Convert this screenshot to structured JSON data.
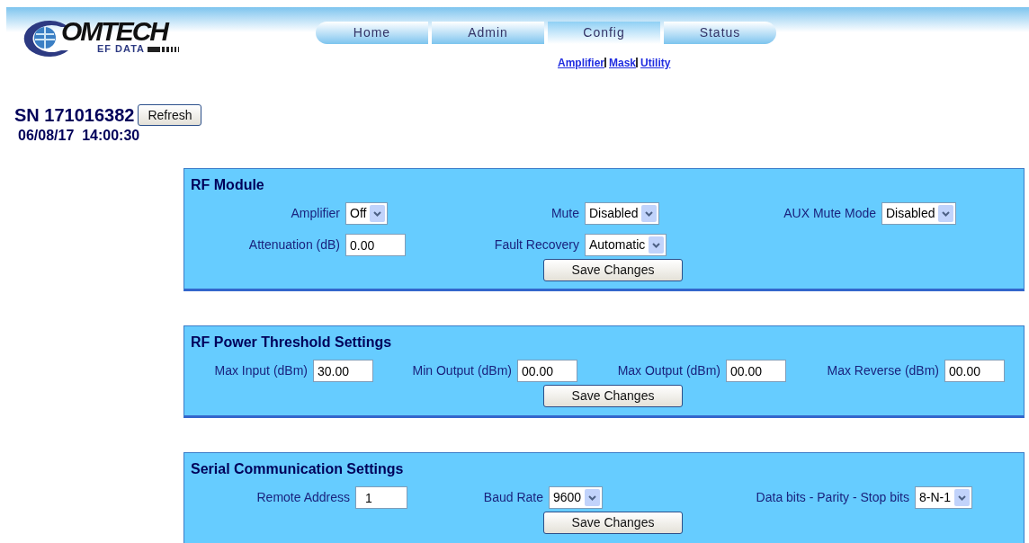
{
  "logo": {
    "wordmark": "OMTECH",
    "subtitle": "EF DATA"
  },
  "tabs": [
    {
      "label": "Home",
      "selected": false
    },
    {
      "label": "Admin",
      "selected": false
    },
    {
      "label": "Config",
      "selected": true
    },
    {
      "label": "Status",
      "selected": false
    }
  ],
  "sub_links": [
    "Amplifier",
    "Mask",
    "Utility"
  ],
  "serial_number": "SN 171016382",
  "refresh_button": "Refresh",
  "datetime": "06/08/17  14:00:30",
  "panels": [
    {
      "title": "RF Module",
      "rows": [
        [
          {
            "label": "Amplifier",
            "kind": "select",
            "value": "Off"
          },
          {
            "label": "Mute",
            "kind": "select",
            "value": "Disabled"
          },
          {
            "label": "AUX Mute Mode",
            "kind": "select",
            "value": "Disabled"
          }
        ],
        [
          {
            "label": "Attenuation (dB)",
            "kind": "text",
            "value": "0.00"
          },
          {
            "label": "Fault Recovery",
            "kind": "select",
            "value": "Automatic"
          }
        ]
      ],
      "button": "Save Changes"
    },
    {
      "title": "RF Power Threshold Settings",
      "rows": [
        [
          {
            "label": "Max Input (dBm)",
            "kind": "text",
            "value": "30.00"
          },
          {
            "label": "Min Output (dBm)",
            "kind": "text",
            "value": "00.00"
          },
          {
            "label": "Max Output (dBm)",
            "kind": "text",
            "value": "00.00"
          },
          {
            "label": "Max Reverse (dBm)",
            "kind": "text",
            "value": "00.00"
          }
        ]
      ],
      "button": "Save Changes"
    },
    {
      "title": "Serial Communication Settings",
      "rows": [
        [
          {
            "label": "Remote Address",
            "kind": "text",
            "value": "1"
          },
          {
            "label": "Baud Rate",
            "kind": "select",
            "value": "9600"
          },
          {
            "label": "Data bits - Parity - Stop bits",
            "kind": "select",
            "value": "8-N-1"
          }
        ]
      ],
      "button": "Save Changes"
    }
  ]
}
